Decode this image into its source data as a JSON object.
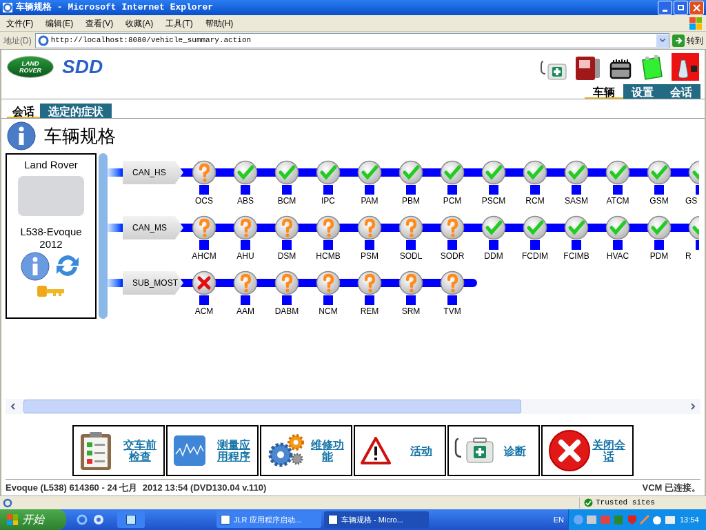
{
  "window": {
    "title": "车辆规格 - Microsoft Internet Explorer"
  },
  "menu": [
    "文件(F)",
    "编辑(E)",
    "查看(V)",
    "收藏(A)",
    "工具(T)",
    "帮助(H)"
  ],
  "address": {
    "label": "地址(D)",
    "url": "http://localhost:8080/vehicle_summary.action",
    "go": "转到"
  },
  "brand": {
    "badge_top": "LAND",
    "badge_bottom": "ROVER",
    "product": "SDD"
  },
  "top_tabs": [
    {
      "label": "车辆",
      "selected": true
    },
    {
      "label": "设置",
      "selected": false
    },
    {
      "label": "会话",
      "selected": false
    }
  ],
  "page_tabs": [
    {
      "label": "会话",
      "selected": true
    },
    {
      "label": "选定的症状",
      "selected": false
    }
  ],
  "page_title": "车辆规格",
  "vehicle": {
    "make": "Land Rover",
    "model": "L538-Evoque",
    "year": "2012"
  },
  "networks": [
    {
      "name": "CAN_HS",
      "nodes": [
        {
          "label": "OCS",
          "kind": "unknown"
        },
        {
          "label": "ABS",
          "kind": "ok"
        },
        {
          "label": "BCM",
          "kind": "ok"
        },
        {
          "label": "IPC",
          "kind": "ok"
        },
        {
          "label": "PAM",
          "kind": "ok"
        },
        {
          "label": "PBM",
          "kind": "ok"
        },
        {
          "label": "PCM",
          "kind": "ok"
        },
        {
          "label": "PSCM",
          "kind": "ok"
        },
        {
          "label": "RCM",
          "kind": "ok"
        },
        {
          "label": "SASM",
          "kind": "ok"
        },
        {
          "label": "ATCM",
          "kind": "ok"
        },
        {
          "label": "GSM",
          "kind": "ok"
        },
        {
          "label": "GS",
          "kind": "ok",
          "clipped": true
        }
      ]
    },
    {
      "name": "CAN_MS",
      "nodes": [
        {
          "label": "AHCM",
          "kind": "unknown"
        },
        {
          "label": "AHU",
          "kind": "unknown"
        },
        {
          "label": "DSM",
          "kind": "unknown"
        },
        {
          "label": "HCMB",
          "kind": "unknown"
        },
        {
          "label": "PSM",
          "kind": "unknown"
        },
        {
          "label": "SODL",
          "kind": "unknown"
        },
        {
          "label": "SODR",
          "kind": "unknown"
        },
        {
          "label": "DDM",
          "kind": "ok"
        },
        {
          "label": "FCDIM",
          "kind": "ok"
        },
        {
          "label": "FCIMB",
          "kind": "ok"
        },
        {
          "label": "HVAC",
          "kind": "ok"
        },
        {
          "label": "PDM",
          "kind": "ok"
        },
        {
          "label": "R",
          "kind": "ok",
          "clipped": true
        }
      ]
    },
    {
      "name": "SUB_MOST",
      "nodes": [
        {
          "label": "ACM",
          "kind": "error"
        },
        {
          "label": "AAM",
          "kind": "unknown"
        },
        {
          "label": "DABM",
          "kind": "unknown"
        },
        {
          "label": "NCM",
          "kind": "unknown"
        },
        {
          "label": "REM",
          "kind": "unknown"
        },
        {
          "label": "SRM",
          "kind": "unknown"
        },
        {
          "label": "TVM",
          "kind": "unknown"
        }
      ]
    }
  ],
  "actions": [
    "交车前检查",
    "测量应用程序",
    "维修功能",
    "活动",
    "诊断",
    "关闭会话"
  ],
  "status": {
    "left": "Evoque (L538) 614360 - 24 七月  2012 13:54 (DVD130.04 v.110)",
    "right": "VCM 已连接。"
  },
  "ie_status": {
    "zone": "Trusted sites"
  },
  "taskbar": {
    "start": "开始",
    "tasks": [
      {
        "label": "JLR 应用程序启动...",
        "selected": false
      },
      {
        "label": "车辆规格 - Micro...",
        "selected": true
      }
    ],
    "lang": "EN",
    "clock": "13:54"
  }
}
